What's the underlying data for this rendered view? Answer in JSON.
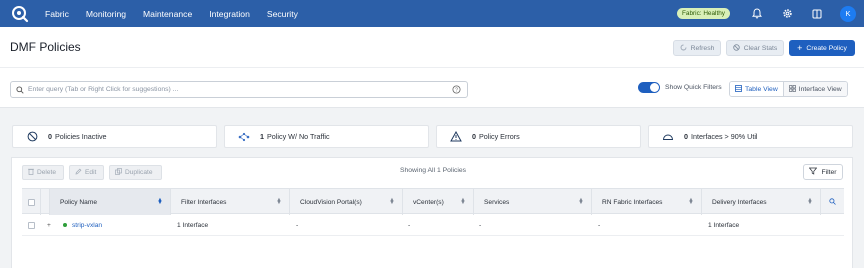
{
  "nav": {
    "items": [
      "Fabric",
      "Monitoring",
      "Maintenance",
      "Integration",
      "Security"
    ],
    "fabric_status": "Fabric: Healthy",
    "avatar_initial": "K",
    "icons": [
      "logo-icon",
      "bell-icon",
      "gear-icon",
      "book-icon"
    ]
  },
  "page": {
    "title": "DMF Policies",
    "refresh_label": "Refresh",
    "clear_stats_label": "Clear Stats",
    "create_label": "Create Policy"
  },
  "search": {
    "placeholder": "Enter query (Tab or Right Click for suggestions) ..."
  },
  "quick_filters": {
    "label": "Show Quick Filters",
    "enabled": true
  },
  "views": {
    "table_label": "Table View",
    "interface_label": "Interface View",
    "active": "Table View"
  },
  "stats": [
    {
      "count": "0",
      "text": "Policies Inactive",
      "icon": "inactive-icon"
    },
    {
      "count": "1",
      "text": "Policy W/ No Traffic",
      "icon": "traffic-icon"
    },
    {
      "count": "0",
      "text": "Policy Errors",
      "icon": "warning-icon"
    },
    {
      "count": "0",
      "text": "Interfaces > 90% Util",
      "icon": "gauge-icon"
    }
  ],
  "table": {
    "delete_label": "Delete",
    "edit_label": "Edit",
    "duplicate_label": "Duplicate",
    "showing_text": "Showing All 1 Policies",
    "filter_label": "Filter",
    "columns": [
      "Policy Name",
      "Filter Interfaces",
      "CloudVision Portal(s)",
      "vCenter(s)",
      "Services",
      "RN Fabric Interfaces",
      "Delivery Interfaces"
    ],
    "rows": [
      {
        "expand": "+",
        "policy_name": "strip-vxlan",
        "status_color": "#2e9e3a",
        "filter_interfaces": "1 Interface",
        "cloudvision": "-",
        "vcenter": "-",
        "services": "-",
        "rn_fabric": "-",
        "delivery": "1 Interface"
      }
    ]
  },
  "colors": {
    "nav_bg": "#2c5fa8",
    "primary": "#1e5fbf",
    "link": "#1e5fbf"
  }
}
